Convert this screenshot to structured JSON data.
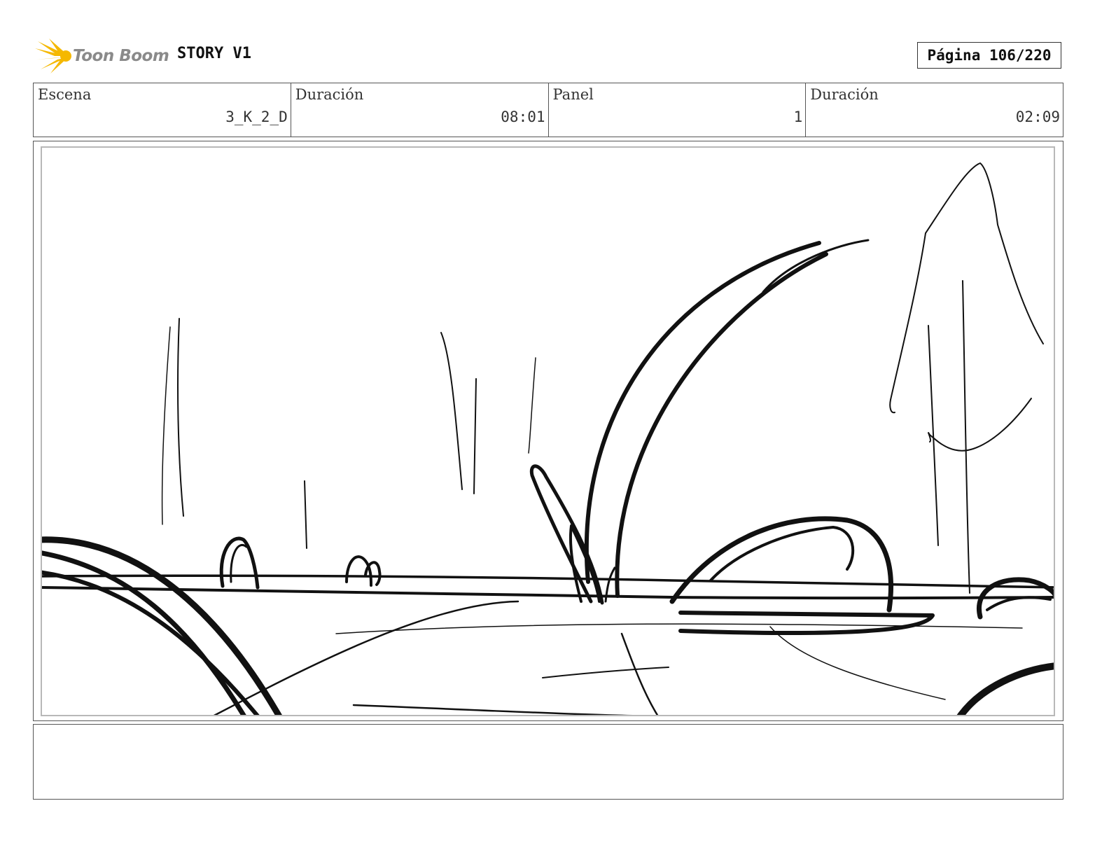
{
  "header": {
    "brand": "Toon Boom",
    "project_title": "STORY V1",
    "page_label": "Página 106/220"
  },
  "info": {
    "scene_label": "Escena",
    "scene_value": "3_K_2_D",
    "scene_duration_label": "Duración",
    "scene_duration_value": "08:01",
    "panel_label": "Panel",
    "panel_value": "1",
    "panel_duration_label": "Duración",
    "panel_duration_value": "02:09"
  },
  "notes": {
    "text": ""
  },
  "colors": {
    "logo_accent": "#f5b800",
    "logo_text": "#8a8a8a",
    "ink": "#111111"
  }
}
